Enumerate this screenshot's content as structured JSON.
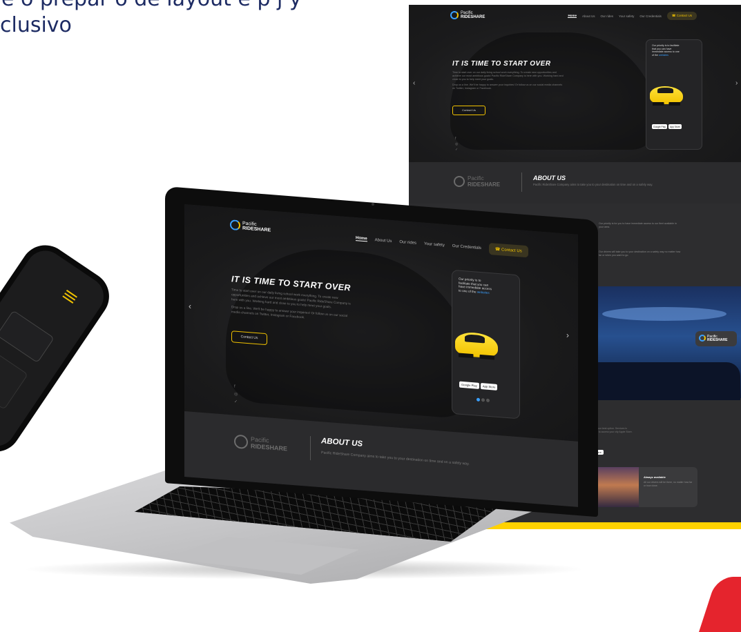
{
  "heading_fragment": {
    "line1": "e o prepar   o de layout e p   j     y",
    "line2": "clusivo"
  },
  "brand": {
    "logo_line1": "Pacific",
    "logo_line2": "RIDESHARE",
    "accent_color": "#f2c300",
    "link_color": "#3aa0ff",
    "background_color": "#1f1f21"
  },
  "nav": {
    "items": [
      "Home",
      "About Us",
      "Our rides",
      "Your safety",
      "Our Credentials"
    ],
    "cta": "Contact Us",
    "cta_icon": "phone-icon"
  },
  "hero": {
    "title": "IT IS TIME TO START OVER",
    "paragraph1": "Time to start over on our daily living school work everything. To create new opportunities and achieve our most ambitious goals! Pacific RideShare Company is here with you. Working hard and close to you to help meet your goals.",
    "paragraph2": "Drop us a line. We'll be happy to answer your inquiries! Or follow us on our social media channels on Twitter, Instagram or Facebook.",
    "button": "Contact Us",
    "prev_arrow": "‹",
    "next_arrow": "›"
  },
  "phone_card": {
    "text": "Our priority is to facilitate that you can have immediate access to one of the",
    "link": "websites",
    "google_play": "Google Play",
    "app_store": "App Store"
  },
  "social_icons": [
    "facebook-icon",
    "instagram-icon",
    "twitter-icon"
  ],
  "about": {
    "title": "ABOUT US",
    "text": "Pacific RideShare Company aims to take you to your destination on time and on a safely way."
  },
  "features": [
    {
      "text": "Our priority is for you to have immediate access to our fleet available in your area.",
      "icon": "shield-icon"
    },
    {
      "text": "Our drivers will take you to your destination on a safely way no matter how far or when you want to go.",
      "icon": "car-icon"
    }
  ],
  "features_section": {
    "title": "ES",
    "subtitle": "pany is your best option. Services is available to access your city Apple Store.",
    "app_button": "App Store",
    "card_title": "Always available",
    "card_text": "All our drivers will be there, no matter how far or how close."
  }
}
